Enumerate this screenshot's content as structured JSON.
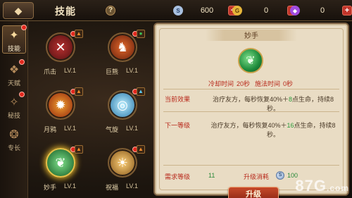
{
  "header": {
    "back_glyph": "◆",
    "title": "技能",
    "help": "?"
  },
  "currencies": [
    {
      "icon": "silver-coin-icon",
      "glyph": "S",
      "value": "600",
      "color": "#a8c0e0"
    },
    {
      "icon": "gold-coin-icon",
      "glyph": "G",
      "value": "0",
      "color": "#e6b63a"
    },
    {
      "icon": "purple-gem-icon",
      "glyph": "◆",
      "value": "0",
      "color": "#a04ce0"
    }
  ],
  "sidetabs": [
    {
      "label": "技能",
      "glyph": "✦"
    },
    {
      "label": "天赋",
      "glyph": "❖"
    },
    {
      "label": "秘技",
      "glyph": "✧"
    },
    {
      "label": "专长",
      "glyph": "❂"
    }
  ],
  "skills": [
    {
      "name": "爪击",
      "level": "LV.1",
      "glyph": "✕",
      "bg": "#8a1e1e"
    },
    {
      "name": "巨熊",
      "level": "LV.1",
      "glyph": "♞",
      "bg": "#b6401a"
    },
    {
      "name": "月鸦",
      "level": "LV.1",
      "glyph": "✹",
      "bg": "#c23a16"
    },
    {
      "name": "气旋",
      "level": "LV.1",
      "glyph": "◎",
      "bg": "#2a9ad0"
    },
    {
      "name": "妙手",
      "level": "LV.1",
      "glyph": "❦",
      "bg": "#2a9a3a"
    },
    {
      "name": "祝福",
      "level": "LV.1",
      "glyph": "☀",
      "bg": "#d8902a"
    }
  ],
  "detail": {
    "title": "妙手",
    "cooldown_label": "冷却时间",
    "cooldown_value": "20秒",
    "cast_label": "施法时间",
    "cast_value": "0秒",
    "current_label": "当前效果",
    "current_text_a": "治疗友方，每秒恢复40%＋",
    "current_text_g": "8",
    "current_text_b": "点生命，持续8秒。",
    "next_label": "下一等级",
    "next_text_a": "治疗友方，每秒恢复40%＋",
    "next_text_g": "16",
    "next_text_b": "点生命，持续8秒。",
    "req_label": "需求等级",
    "req_value": "11",
    "cost_label": "升级消耗",
    "cost_value": "100",
    "upgrade_label": "升级"
  },
  "watermark": {
    "main": "87G",
    "sub": ".com"
  }
}
